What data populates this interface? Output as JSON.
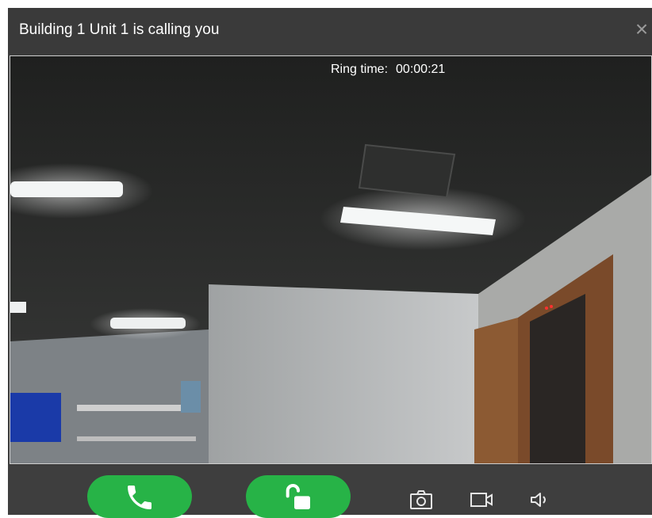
{
  "dialog": {
    "title": "Building 1 Unit 1 is calling you",
    "close_glyph": "×"
  },
  "video": {
    "ring_label": "Ring time:",
    "ring_time": "00:00:21"
  },
  "controls": {
    "answer_icon": "phone-icon",
    "unlock_icon": "unlock-icon",
    "snapshot_icon": "camera-icon",
    "record_icon": "video-camera-icon",
    "volume_icon": "speaker-icon",
    "accent_color": "#27b347"
  }
}
